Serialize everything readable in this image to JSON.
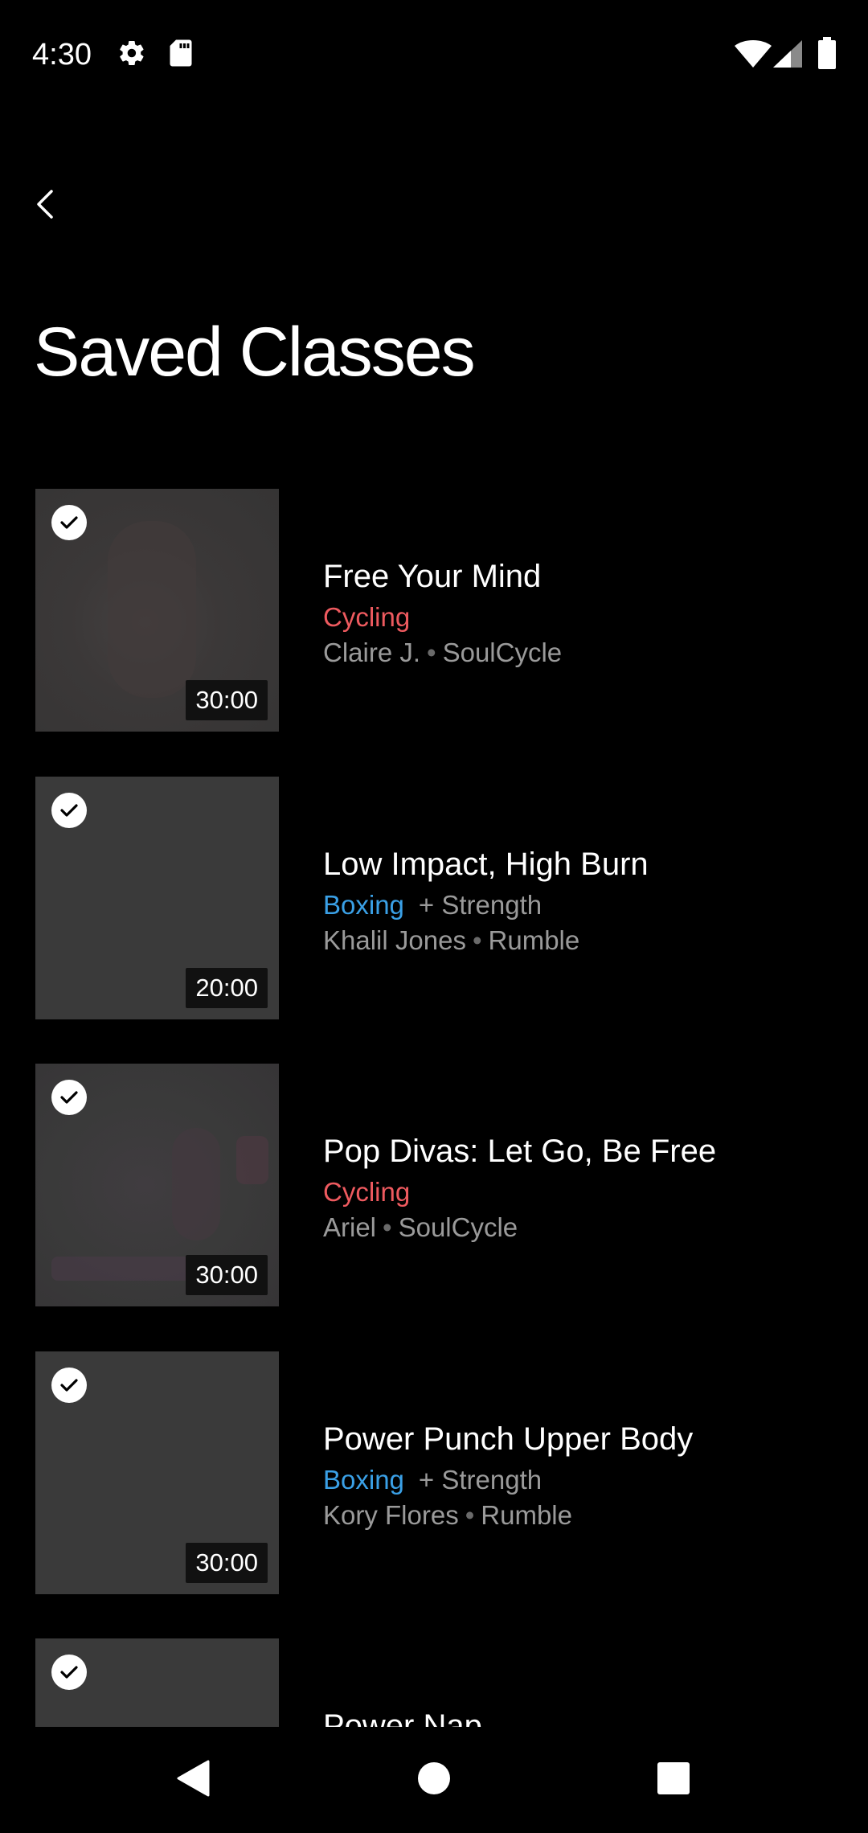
{
  "status_bar": {
    "time": "4:30",
    "icons": [
      "gear-icon",
      "sd-card-icon",
      "wifi-icon",
      "cellular-signal-icon",
      "battery-icon"
    ]
  },
  "header": {
    "back_icon": "chevron-left-icon",
    "title": "Saved Classes"
  },
  "colors": {
    "background": "#000000",
    "cycling": "#ee5a5f",
    "boxing": "#3aa0e6",
    "secondary_text": "#9a9a9a"
  },
  "classes": [
    {
      "title": "Free Your Mind",
      "discipline": "Cycling",
      "extra": "",
      "instructor": "Claire J.",
      "studio": "SoulCycle",
      "duration": "30:00",
      "saved": true
    },
    {
      "title": "Low Impact, High Burn",
      "discipline": "Boxing",
      "extra": "+ Strength",
      "instructor": "Khalil Jones",
      "studio": "Rumble",
      "duration": "20:00",
      "saved": true
    },
    {
      "title": "Pop Divas: Let Go, Be Free",
      "discipline": "Cycling",
      "extra": "",
      "instructor": "Ariel",
      "studio": "SoulCycle",
      "duration": "30:00",
      "saved": true
    },
    {
      "title": "Power Punch Upper Body",
      "discipline": "Boxing",
      "extra": "+ Strength",
      "instructor": "Kory Flores",
      "studio": "Rumble",
      "duration": "30:00",
      "saved": true
    },
    {
      "title": "Power Nap",
      "saved": true
    }
  ],
  "nav_bar": {
    "icons": [
      "back-triangle-icon",
      "home-circle-icon",
      "recents-square-icon"
    ]
  }
}
